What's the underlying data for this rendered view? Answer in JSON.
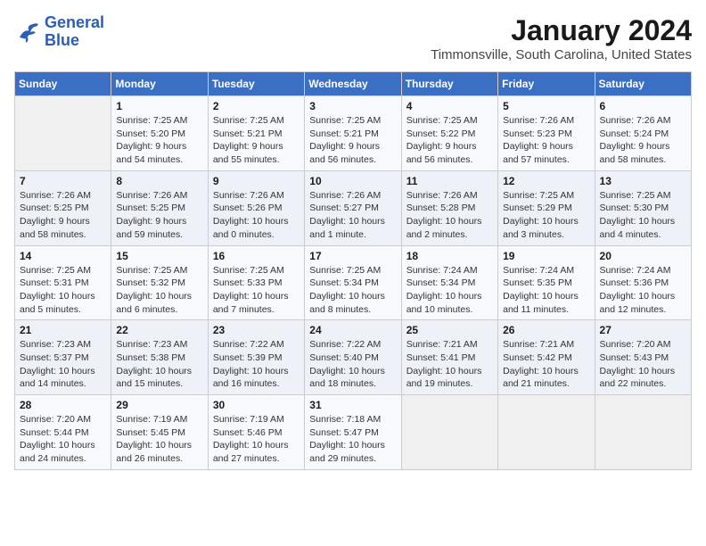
{
  "header": {
    "logo_text_general": "General",
    "logo_text_blue": "Blue",
    "month_title": "January 2024",
    "location": "Timmonsville, South Carolina, United States"
  },
  "calendar": {
    "days_of_week": [
      "Sunday",
      "Monday",
      "Tuesday",
      "Wednesday",
      "Thursday",
      "Friday",
      "Saturday"
    ],
    "weeks": [
      [
        {
          "day": "",
          "info": ""
        },
        {
          "day": "1",
          "info": "Sunrise: 7:25 AM\nSunset: 5:20 PM\nDaylight: 9 hours\nand 54 minutes."
        },
        {
          "day": "2",
          "info": "Sunrise: 7:25 AM\nSunset: 5:21 PM\nDaylight: 9 hours\nand 55 minutes."
        },
        {
          "day": "3",
          "info": "Sunrise: 7:25 AM\nSunset: 5:21 PM\nDaylight: 9 hours\nand 56 minutes."
        },
        {
          "day": "4",
          "info": "Sunrise: 7:25 AM\nSunset: 5:22 PM\nDaylight: 9 hours\nand 56 minutes."
        },
        {
          "day": "5",
          "info": "Sunrise: 7:26 AM\nSunset: 5:23 PM\nDaylight: 9 hours\nand 57 minutes."
        },
        {
          "day": "6",
          "info": "Sunrise: 7:26 AM\nSunset: 5:24 PM\nDaylight: 9 hours\nand 58 minutes."
        }
      ],
      [
        {
          "day": "7",
          "info": "Sunrise: 7:26 AM\nSunset: 5:25 PM\nDaylight: 9 hours\nand 58 minutes."
        },
        {
          "day": "8",
          "info": "Sunrise: 7:26 AM\nSunset: 5:25 PM\nDaylight: 9 hours\nand 59 minutes."
        },
        {
          "day": "9",
          "info": "Sunrise: 7:26 AM\nSunset: 5:26 PM\nDaylight: 10 hours\nand 0 minutes."
        },
        {
          "day": "10",
          "info": "Sunrise: 7:26 AM\nSunset: 5:27 PM\nDaylight: 10 hours\nand 1 minute."
        },
        {
          "day": "11",
          "info": "Sunrise: 7:26 AM\nSunset: 5:28 PM\nDaylight: 10 hours\nand 2 minutes."
        },
        {
          "day": "12",
          "info": "Sunrise: 7:25 AM\nSunset: 5:29 PM\nDaylight: 10 hours\nand 3 minutes."
        },
        {
          "day": "13",
          "info": "Sunrise: 7:25 AM\nSunset: 5:30 PM\nDaylight: 10 hours\nand 4 minutes."
        }
      ],
      [
        {
          "day": "14",
          "info": "Sunrise: 7:25 AM\nSunset: 5:31 PM\nDaylight: 10 hours\nand 5 minutes."
        },
        {
          "day": "15",
          "info": "Sunrise: 7:25 AM\nSunset: 5:32 PM\nDaylight: 10 hours\nand 6 minutes."
        },
        {
          "day": "16",
          "info": "Sunrise: 7:25 AM\nSunset: 5:33 PM\nDaylight: 10 hours\nand 7 minutes."
        },
        {
          "day": "17",
          "info": "Sunrise: 7:25 AM\nSunset: 5:34 PM\nDaylight: 10 hours\nand 8 minutes."
        },
        {
          "day": "18",
          "info": "Sunrise: 7:24 AM\nSunset: 5:34 PM\nDaylight: 10 hours\nand 10 minutes."
        },
        {
          "day": "19",
          "info": "Sunrise: 7:24 AM\nSunset: 5:35 PM\nDaylight: 10 hours\nand 11 minutes."
        },
        {
          "day": "20",
          "info": "Sunrise: 7:24 AM\nSunset: 5:36 PM\nDaylight: 10 hours\nand 12 minutes."
        }
      ],
      [
        {
          "day": "21",
          "info": "Sunrise: 7:23 AM\nSunset: 5:37 PM\nDaylight: 10 hours\nand 14 minutes."
        },
        {
          "day": "22",
          "info": "Sunrise: 7:23 AM\nSunset: 5:38 PM\nDaylight: 10 hours\nand 15 minutes."
        },
        {
          "day": "23",
          "info": "Sunrise: 7:22 AM\nSunset: 5:39 PM\nDaylight: 10 hours\nand 16 minutes."
        },
        {
          "day": "24",
          "info": "Sunrise: 7:22 AM\nSunset: 5:40 PM\nDaylight: 10 hours\nand 18 minutes."
        },
        {
          "day": "25",
          "info": "Sunrise: 7:21 AM\nSunset: 5:41 PM\nDaylight: 10 hours\nand 19 minutes."
        },
        {
          "day": "26",
          "info": "Sunrise: 7:21 AM\nSunset: 5:42 PM\nDaylight: 10 hours\nand 21 minutes."
        },
        {
          "day": "27",
          "info": "Sunrise: 7:20 AM\nSunset: 5:43 PM\nDaylight: 10 hours\nand 22 minutes."
        }
      ],
      [
        {
          "day": "28",
          "info": "Sunrise: 7:20 AM\nSunset: 5:44 PM\nDaylight: 10 hours\nand 24 minutes."
        },
        {
          "day": "29",
          "info": "Sunrise: 7:19 AM\nSunset: 5:45 PM\nDaylight: 10 hours\nand 26 minutes."
        },
        {
          "day": "30",
          "info": "Sunrise: 7:19 AM\nSunset: 5:46 PM\nDaylight: 10 hours\nand 27 minutes."
        },
        {
          "day": "31",
          "info": "Sunrise: 7:18 AM\nSunset: 5:47 PM\nDaylight: 10 hours\nand 29 minutes."
        },
        {
          "day": "",
          "info": ""
        },
        {
          "day": "",
          "info": ""
        },
        {
          "day": "",
          "info": ""
        }
      ]
    ]
  }
}
